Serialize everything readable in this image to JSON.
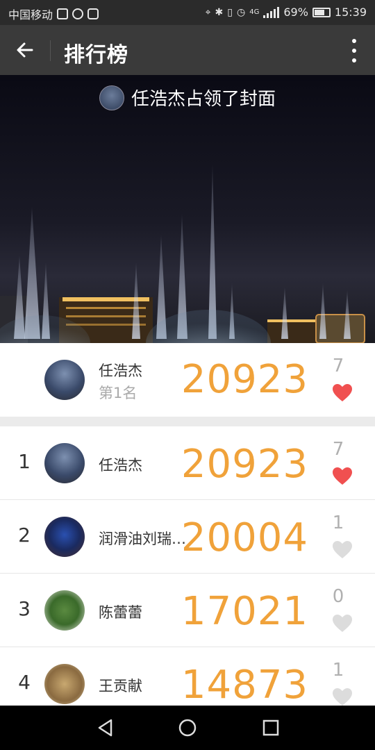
{
  "status_bar": {
    "carrier": "中国移动",
    "battery": "69%",
    "battery_level": 0.69,
    "time": "15:39",
    "network": "4G"
  },
  "header": {
    "title": "排行榜",
    "back_icon": "arrow-left-icon",
    "more_icon": "more-vertical-icon"
  },
  "cover": {
    "caption": "任浩杰占领了封面"
  },
  "champion": {
    "name": "任浩杰",
    "subtitle": "第1名",
    "steps": "20923",
    "likes": "7",
    "liked": true
  },
  "ranking": [
    {
      "rank": "1",
      "name": "任浩杰",
      "steps": "20923",
      "likes": "7",
      "liked": true
    },
    {
      "rank": "2",
      "name": "润滑油刘瑞…",
      "steps": "20004",
      "likes": "1",
      "liked": false
    },
    {
      "rank": "3",
      "name": "陈蕾蕾",
      "steps": "17021",
      "likes": "0",
      "liked": false
    },
    {
      "rank": "4",
      "name": "王贡献",
      "steps": "14873",
      "likes": "1",
      "liked": false
    }
  ],
  "colors": {
    "accent": "#f0a23a",
    "heart_active": "#f05050",
    "heart_inactive": "#dcdcdc"
  }
}
